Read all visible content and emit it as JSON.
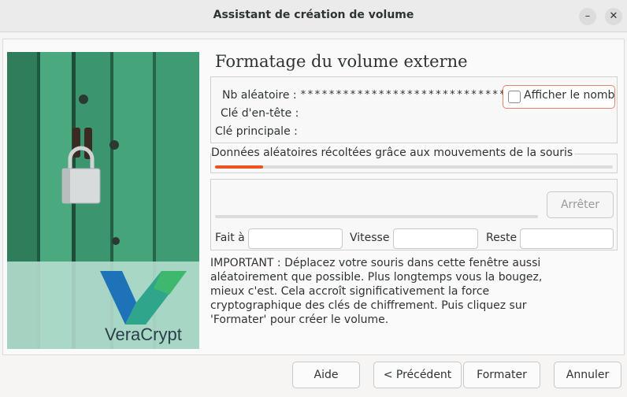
{
  "window": {
    "title": "Assistant de création de volume",
    "minimize_symbol": "–",
    "close_symbol": "✕"
  },
  "logo": {
    "text": "VeraCrypt"
  },
  "page": {
    "heading": "Formatage du volume externe"
  },
  "keys": {
    "random_label": "Nb aléatoire :",
    "random_value": "******************************",
    "header_key_label": "Clé d'en-tête :",
    "master_key_label": "Clé principale :",
    "show_checkbox_label": "Afficher le nombre",
    "show_checked": false
  },
  "mouse": {
    "label": "Données aléatoires récoltées grâce aux mouvements de la souris",
    "progress": 0.12
  },
  "progress": {
    "stop_label": "Arrêter",
    "done_label": "Fait à",
    "speed_label": "Vitesse",
    "remaining_label": "Reste",
    "done_value": "",
    "speed_value": "",
    "remaining_value": ""
  },
  "important": "IMPORTANT : Déplacez votre souris dans cette fenêtre aussi aléatoirement que possible. Plus longtemps vous la bougez, mieux c'est. Cela accroît significativement la force cryptographique des clés de chiffrement. Puis cliquez sur 'Formater' pour créer le volume.",
  "buttons": {
    "help": "Aide",
    "previous": "< Précédent",
    "format": "Formater",
    "cancel": "Annuler"
  },
  "colors": {
    "accent": "#e95420",
    "checkbox_focus": "#e8846a",
    "door_green": "#3e9a70"
  }
}
